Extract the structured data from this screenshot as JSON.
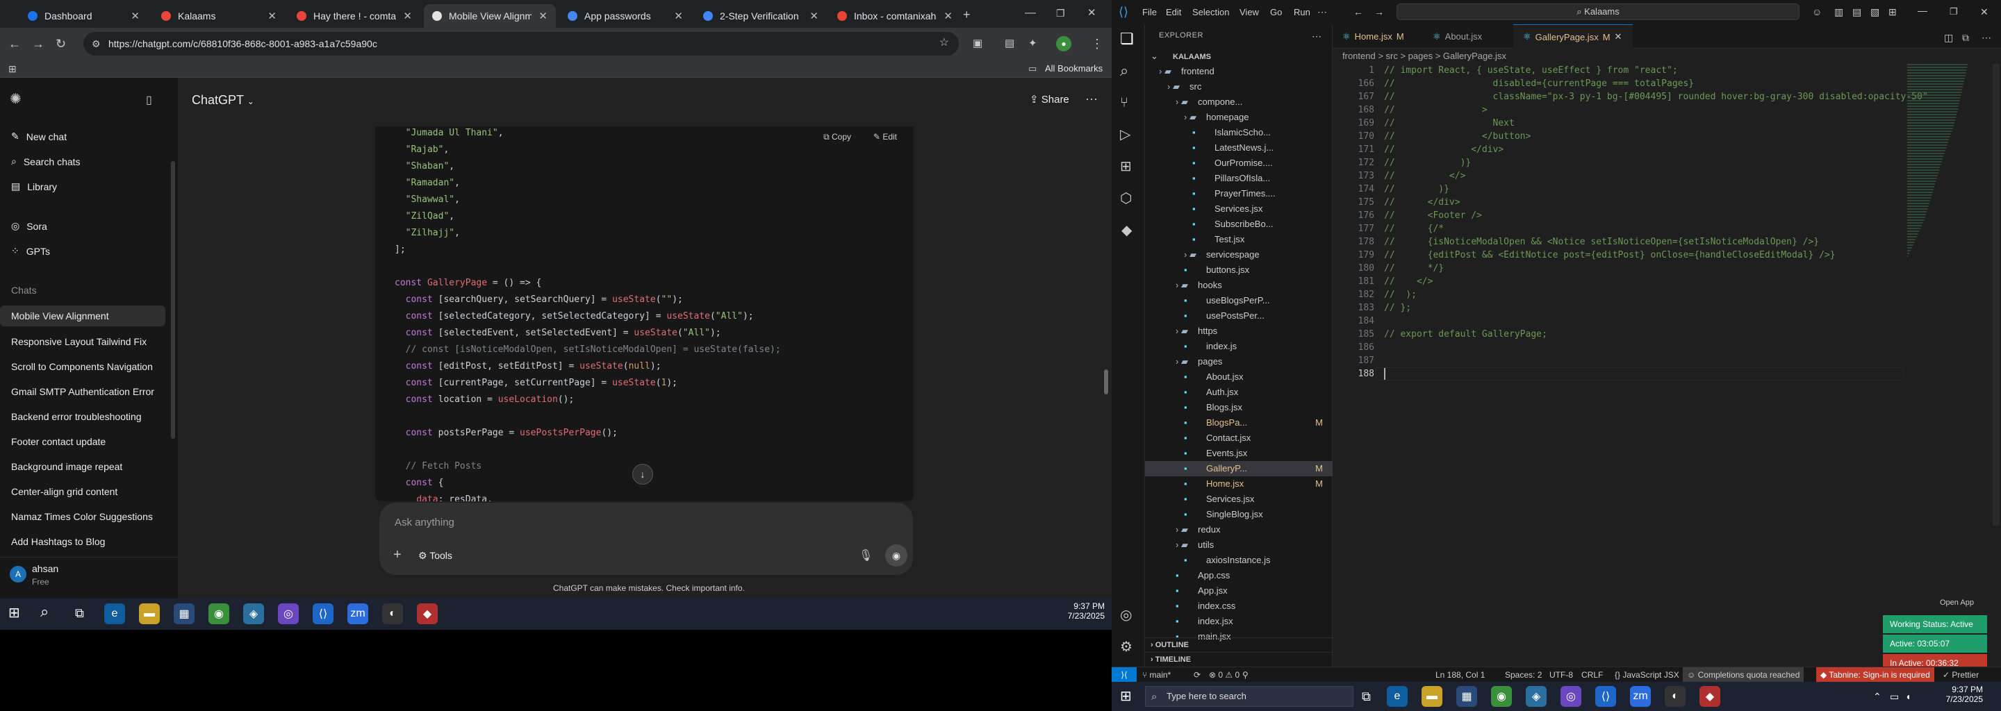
{
  "browser": {
    "tabs": [
      {
        "label": "Dashboard",
        "color": "#1a73e8"
      },
      {
        "label": "Kalaams",
        "color": "#e8453c"
      },
      {
        "label": "Hay there ! - comtan",
        "color": "#e8453c"
      },
      {
        "label": "Mobile View Alignmen",
        "color": "#e3e3e3"
      },
      {
        "label": "App passwords",
        "color": "#4285f4"
      },
      {
        "label": "2-Step Verification",
        "color": "#4285f4"
      },
      {
        "label": "Inbox - comtanixahsa",
        "color": "#ea4335"
      }
    ],
    "url": "https://chatgpt.com/c/68810f36-868c-8001-a983-a1a7c59a90c",
    "bookmarks_label": "All Bookmarks"
  },
  "chatgpt": {
    "header_title": "ChatGPT",
    "share_label": "Share",
    "sidebar": {
      "top_items": [
        "New chat",
        "Search chats",
        "Library"
      ],
      "apps": [
        "Sora",
        "GPTs"
      ],
      "chats_heading": "Chats",
      "chats": [
        "Mobile View Alignment",
        "Responsive Layout Tailwind Fix",
        "Scroll to Components Navigation",
        "Gmail SMTP Authentication Error",
        "Backend error troubleshooting",
        "Footer contact update",
        "Background image repeat",
        "Center-align grid content",
        "Namaz Times Color Suggestions",
        "Add Hashtags to Blog"
      ],
      "user_name": "ahsan",
      "user_plan": "Free",
      "user_initial": "A"
    },
    "code_actions": {
      "copy": "Copy",
      "edit": "Edit"
    },
    "composer_placeholder": "Ask anything",
    "tools_label": "Tools",
    "disclaimer": "ChatGPT can make mistakes. Check important info."
  },
  "windows": {
    "time": "9:37 PM",
    "date": "7/23/2025",
    "search_placeholder": "Type here to search"
  },
  "vscode": {
    "menu": [
      "File",
      "Edit",
      "Selection",
      "View",
      "Go",
      "Run"
    ],
    "search": "Kalaams",
    "explorer_title": "EXPLORER",
    "tabs": [
      {
        "label": "Home.jsx",
        "badge": "M"
      },
      {
        "label": "About.jsx",
        "badge": ""
      },
      {
        "label": "GalleryPage.jsx",
        "badge": "M"
      }
    ],
    "breadcrumb": "frontend > src > pages > GalleryPage.jsx",
    "tree": [
      {
        "label": "KALAAMS",
        "indent": 0,
        "kind": "root"
      },
      {
        "label": "frontend",
        "indent": 1,
        "kind": "folder"
      },
      {
        "label": "src",
        "indent": 2,
        "kind": "folder"
      },
      {
        "label": "compone...",
        "indent": 3,
        "kind": "folder"
      },
      {
        "label": "homepage",
        "indent": 4,
        "kind": "folder"
      },
      {
        "label": "IslamicScho...",
        "indent": 5,
        "kind": "file"
      },
      {
        "label": "LatestNews.j...",
        "indent": 5,
        "kind": "file"
      },
      {
        "label": "OurPromise....",
        "indent": 5,
        "kind": "file"
      },
      {
        "label": "PillarsOfIsla...",
        "indent": 5,
        "kind": "file"
      },
      {
        "label": "PrayerTimes....",
        "indent": 5,
        "kind": "file"
      },
      {
        "label": "Services.jsx",
        "indent": 5,
        "kind": "file"
      },
      {
        "label": "SubscribeBo...",
        "indent": 5,
        "kind": "file"
      },
      {
        "label": "Test.jsx",
        "indent": 5,
        "kind": "file"
      },
      {
        "label": "servicespage",
        "indent": 4,
        "kind": "folder"
      },
      {
        "label": "buttons.jsx",
        "indent": 4,
        "kind": "file"
      },
      {
        "label": "hooks",
        "indent": 3,
        "kind": "folder"
      },
      {
        "label": "useBlogsPerP...",
        "indent": 4,
        "kind": "file"
      },
      {
        "label": "usePostsPer...",
        "indent": 4,
        "kind": "file"
      },
      {
        "label": "https",
        "indent": 3,
        "kind": "folder"
      },
      {
        "label": "index.js",
        "indent": 4,
        "kind": "file"
      },
      {
        "label": "pages",
        "indent": 3,
        "kind": "folder"
      },
      {
        "label": "About.jsx",
        "indent": 4,
        "kind": "file"
      },
      {
        "label": "Auth.jsx",
        "indent": 4,
        "kind": "file"
      },
      {
        "label": "Blogs.jsx",
        "indent": 4,
        "kind": "file"
      },
      {
        "label": "BlogsPa...",
        "indent": 4,
        "kind": "file",
        "badge": "M"
      },
      {
        "label": "Contact.jsx",
        "indent": 4,
        "kind": "file"
      },
      {
        "label": "Events.jsx",
        "indent": 4,
        "kind": "file"
      },
      {
        "label": "GalleryP...",
        "indent": 4,
        "kind": "file",
        "badge": "M",
        "selected": true
      },
      {
        "label": "Home.jsx",
        "indent": 4,
        "kind": "file",
        "badge": "M"
      },
      {
        "label": "Services.jsx",
        "indent": 4,
        "kind": "file"
      },
      {
        "label": "SingleBlog.jsx",
        "indent": 4,
        "kind": "file"
      },
      {
        "label": "redux",
        "indent": 3,
        "kind": "folder"
      },
      {
        "label": "utils",
        "indent": 3,
        "kind": "folder"
      },
      {
        "label": "axiosInstance.js",
        "indent": 4,
        "kind": "file"
      },
      {
        "label": "App.css",
        "indent": 3,
        "kind": "file"
      },
      {
        "label": "App.jsx",
        "indent": 3,
        "kind": "file"
      },
      {
        "label": "index.css",
        "indent": 3,
        "kind": "file"
      },
      {
        "label": "index.jsx",
        "indent": 3,
        "kind": "file"
      },
      {
        "label": "main.jsx",
        "indent": 3,
        "kind": "file"
      }
    ],
    "outline_label": "OUTLINE",
    "timeline_label": "TIMELINE",
    "code_first": {
      "num": "1",
      "text": "// import React, { useState, useEffect } from \"react\";"
    },
    "code_lines": [
      {
        "num": "166",
        "text": "//                  disabled={currentPage === totalPages}"
      },
      {
        "num": "167",
        "text": "//                  className=\"px-3 py-1 bg-[#004495] rounded hover:bg-gray-300 disabled:opacity-50\""
      },
      {
        "num": "168",
        "text": "//                >"
      },
      {
        "num": "169",
        "text": "//                  Next"
      },
      {
        "num": "170",
        "text": "//                </button>"
      },
      {
        "num": "171",
        "text": "//              </div>"
      },
      {
        "num": "172",
        "text": "//            )}"
      },
      {
        "num": "173",
        "text": "//          </>"
      },
      {
        "num": "174",
        "text": "//        )}"
      },
      {
        "num": "175",
        "text": "//      </div>"
      },
      {
        "num": "176",
        "text": "//      <Footer />"
      },
      {
        "num": "177",
        "text": "//      {/*"
      },
      {
        "num": "178",
        "text": "//      {isNoticeModalOpen && <Notice setIsNoticeOpen={setIsNoticeModalOpen} />}"
      },
      {
        "num": "179",
        "text": "//      {editPost && <EditNotice post={editPost} onClose={handleCloseEditModal} />}"
      },
      {
        "num": "180",
        "text": "//      */}"
      },
      {
        "num": "181",
        "text": "//    </>"
      },
      {
        "num": "182",
        "text": "//  );"
      },
      {
        "num": "183",
        "text": "// };"
      },
      {
        "num": "184",
        "text": ""
      },
      {
        "num": "185",
        "text": "// export default GalleryPage;"
      },
      {
        "num": "186",
        "text": ""
      },
      {
        "num": "187",
        "text": ""
      },
      {
        "num": "188",
        "text": ""
      }
    ],
    "status": {
      "branch": "main*",
      "problems": "⊗ 0 ⚠ 0",
      "position": "Ln 188, Col 1",
      "spaces": "Spaces: 2",
      "encoding": "UTF-8",
      "eol": "CRLF",
      "language": "JavaScript JSX",
      "quota": "Completions quota reached",
      "tabnine": "Tabnine: Sign-in is required",
      "prettier": "Prettier"
    },
    "app_badges": {
      "header": "Open App",
      "working": "Working Status: Active",
      "active": "Active: 03:05:07",
      "inactive": "In Active: 00:36:32"
    }
  }
}
